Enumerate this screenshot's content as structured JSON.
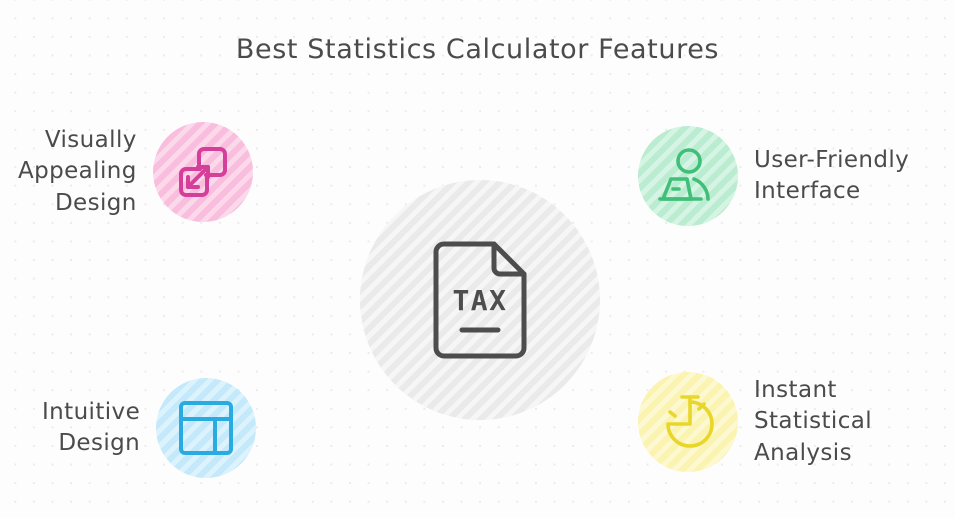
{
  "page": {
    "title": "Best Statistics Calculator Features",
    "background_color": "#fdfdfd",
    "dot_color": "#ebebeb",
    "text_color": "#4b4b4b"
  },
  "hub": {
    "icon_name": "tax-document-icon",
    "icon_label": "TAX",
    "circle_color": "#eaeaea",
    "icon_stroke": "#4d4d4d",
    "arrow_color": "#e6e6e6",
    "arrow_count": 4
  },
  "features": [
    {
      "id": "visually-appealing-design",
      "label": "Visually\nAppealing\nDesign",
      "side": "left",
      "circle_color": "#f9bedd",
      "icon_color": "#d43f9a",
      "icon_name": "resize-expand-icon"
    },
    {
      "id": "user-friendly-interface",
      "label": "User-Friendly\nInterface",
      "side": "right",
      "circle_color": "#b9ecd0",
      "icon_color": "#3fbf77",
      "icon_name": "person-laptop-icon"
    },
    {
      "id": "intuitive-design",
      "label": "Intuitive\nDesign",
      "side": "left",
      "circle_color": "#c4e9fb",
      "icon_color": "#29abe2",
      "icon_name": "layout-wireframe-icon"
    },
    {
      "id": "instant-statistical-analysis",
      "label": "Instant\nStatistical\nAnalysis",
      "side": "right",
      "circle_color": "#fbf3b0",
      "icon_color": "#e8d72a",
      "icon_name": "stopwatch-icon"
    }
  ]
}
